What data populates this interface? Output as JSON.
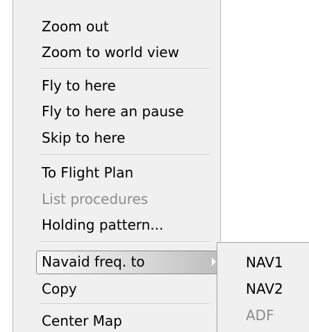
{
  "context_menu": {
    "items": [
      {
        "label": "Zoom out",
        "enabled": true
      },
      {
        "label": "Zoom to world view",
        "enabled": true
      },
      {
        "label": "Fly to here",
        "enabled": true
      },
      {
        "label": "Fly to here an pause",
        "enabled": true
      },
      {
        "label": "Skip to here",
        "enabled": true
      },
      {
        "label": "To Flight Plan",
        "enabled": true
      },
      {
        "label": "List procedures",
        "enabled": false
      },
      {
        "label": "Holding pattern...",
        "enabled": true
      },
      {
        "label": "Navaid freq. to",
        "enabled": true,
        "highlighted": true,
        "has_submenu": true
      },
      {
        "label": "Copy",
        "enabled": true
      },
      {
        "label": "Center Map",
        "enabled": true
      }
    ]
  },
  "submenu": {
    "items": [
      {
        "label": "NAV1",
        "enabled": true
      },
      {
        "label": "NAV2",
        "enabled": true
      },
      {
        "label": "ADF",
        "enabled": false
      }
    ]
  },
  "colors": {
    "menu_background": "#f0f0f0",
    "disabled_text": "#8c8c8c",
    "text": "#000000"
  },
  "icons": {
    "submenu_arrow": "chevron-right-icon"
  }
}
